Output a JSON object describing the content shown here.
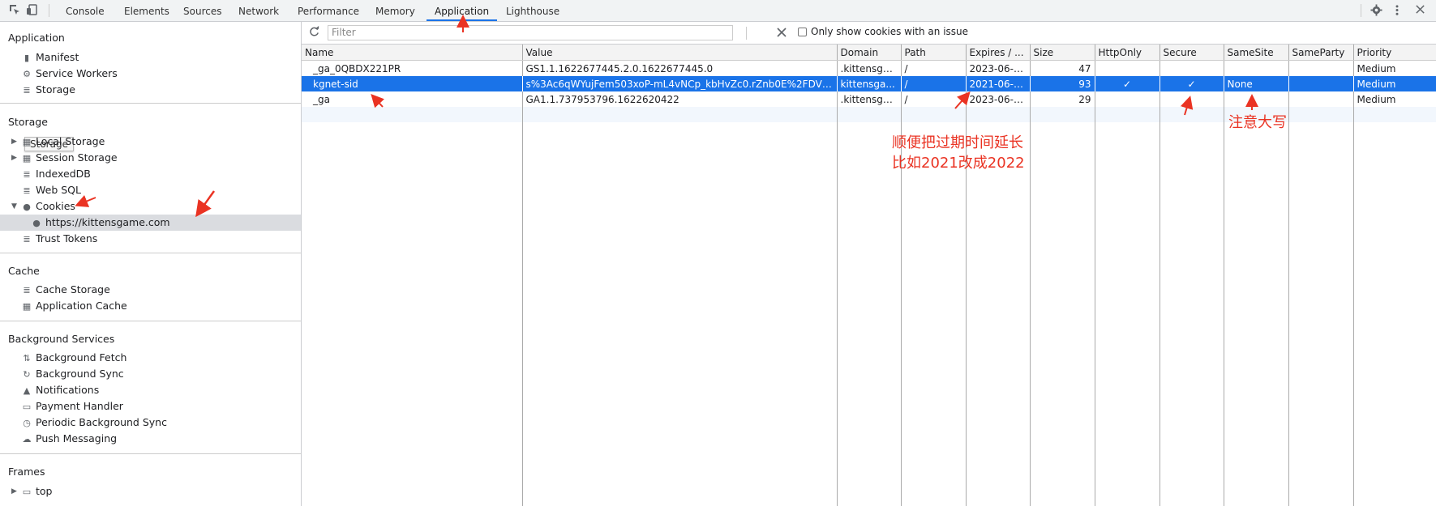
{
  "toolbar": {
    "tabs": [
      "Console",
      "Elements",
      "Sources",
      "Network",
      "Performance",
      "Memory",
      "Application",
      "Lighthouse"
    ],
    "active_tab": "Application"
  },
  "sidebar": {
    "application": {
      "title": "Application",
      "items": [
        "Manifest",
        "Service Workers",
        "Storage"
      ]
    },
    "storage": {
      "title": "Storage",
      "tooltip": "Storage",
      "items": [
        "Local Storage",
        "Session Storage",
        "IndexedDB",
        "Web SQL",
        "Cookies",
        "https://kittensgame.com",
        "Trust Tokens"
      ]
    },
    "cache": {
      "title": "Cache",
      "items": [
        "Cache Storage",
        "Application Cache"
      ]
    },
    "background": {
      "title": "Background Services",
      "items": [
        "Background Fetch",
        "Background Sync",
        "Notifications",
        "Payment Handler",
        "Periodic Background Sync",
        "Push Messaging"
      ]
    },
    "frames": {
      "title": "Frames",
      "items": [
        "top"
      ]
    }
  },
  "filter_bar": {
    "placeholder": "Filter",
    "only_issue_label": "Only show cookies with an issue"
  },
  "cookies_table": {
    "columns": [
      "Name",
      "Value",
      "Domain",
      "Path",
      "Expires / ...",
      "Size",
      "HttpOnly",
      "Secure",
      "SameSite",
      "SameParty",
      "Priority"
    ],
    "rows": [
      {
        "name": "_ga_0QBDX221PR",
        "value": "GS1.1.1622677445.2.0.1622677445.0",
        "domain": ".kittensga...",
        "path": "/",
        "expires": "2023-06-0...",
        "size": "47",
        "httponly": "",
        "secure": "",
        "samesite": "",
        "sameparty": "",
        "priority": "Medium"
      },
      {
        "name": "kgnet-sid",
        "value": "s%3Ac6qWYujFem503xoP-mL4vNCp_kbHvZc0.rZnb0E%2FDV5o...",
        "domain": "kittensga...",
        "path": "/",
        "expires": "2021-06-0...",
        "size": "93",
        "httponly": "✓",
        "secure": "✓",
        "samesite": "None",
        "sameparty": "",
        "priority": "Medium"
      },
      {
        "name": "_ga",
        "value": "GA1.1.737953796.1622620422",
        "domain": ".kittensga...",
        "path": "/",
        "expires": "2023-06-0...",
        "size": "29",
        "httponly": "",
        "secure": "",
        "samesite": "",
        "sameparty": "",
        "priority": "Medium"
      }
    ]
  },
  "annotations": {
    "expires_note_line1": "顺便把过期时间延长",
    "expires_note_line2": "比如2021改成2022",
    "samesite_note": "注意大写"
  },
  "colors": {
    "selection": "#1a73e8",
    "annotation": "#ea3323"
  },
  "icons": [
    "inspect-icon",
    "device-toggle-icon",
    "gear-icon",
    "more-vert-icon",
    "close-icon",
    "refresh-icon",
    "clear-icon"
  ]
}
